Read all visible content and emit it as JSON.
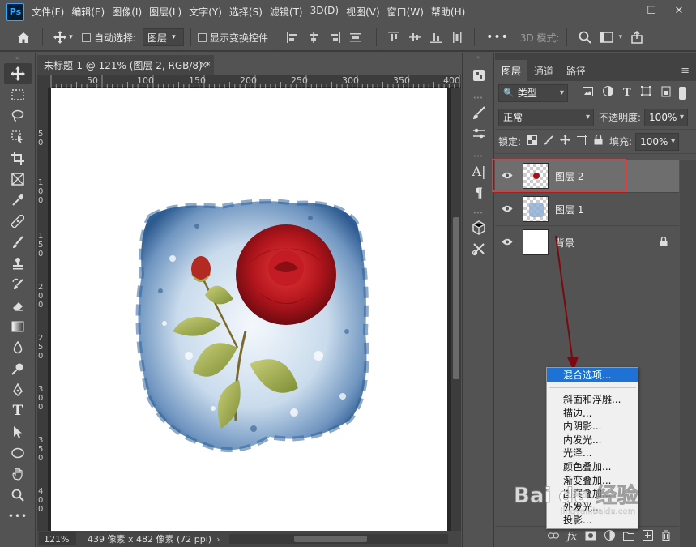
{
  "menubar": {
    "logo": "Ps",
    "items": [
      "文件(F)",
      "编辑(E)",
      "图像(I)",
      "图层(L)",
      "文字(Y)",
      "选择(S)",
      "滤镜(T)",
      "3D(D)",
      "视图(V)",
      "窗口(W)",
      "帮助(H)"
    ],
    "minimize_icon": "—",
    "maximize_icon": "☐",
    "close_icon": "✕"
  },
  "options": {
    "auto_select_label": "自动选择:",
    "auto_select_value": "图层",
    "show_transform_label": "显示变换控件",
    "mode_label": "3D 模式:",
    "more_icon": "•••"
  },
  "document": {
    "tab_title": "未标题-1 @ 121% (图层 2, RGB/8) *",
    "tab_close": "×",
    "ruler_h_ticks": [
      "50",
      "100",
      "150",
      "200",
      "250",
      "300",
      "350",
      "400"
    ],
    "ruler_v_ticks": [
      "50",
      "100",
      "150",
      "200",
      "250",
      "300",
      "350",
      "400",
      "450"
    ]
  },
  "status": {
    "zoom": "121%",
    "doc_info": "439 像素 x 482 像素 (72 ppi)",
    "arrow": "›"
  },
  "layers_panel": {
    "tabs": [
      "图层",
      "通道",
      "路径"
    ],
    "menu_icon": "≡",
    "filter_kind": "类型",
    "blend_mode": "正常",
    "opacity_label": "不透明度:",
    "opacity_value": "100%",
    "lock_label": "锁定:",
    "fill_label": "填充:",
    "fill_value": "100%",
    "layers": [
      {
        "name": "图层 2",
        "selected": true
      },
      {
        "name": "图层 1",
        "selected": false
      },
      {
        "name": "背景",
        "selected": false
      }
    ]
  },
  "context_menu": {
    "items": [
      "混合选项...",
      "斜面和浮雕...",
      "描边...",
      "内阴影...",
      "内发光...",
      "光泽...",
      "颜色叠加...",
      "渐变叠加...",
      "图案叠加...",
      "外发光...",
      "投影..."
    ]
  },
  "watermark": {
    "text": "Bai du 经验",
    "sub": "jingyan.baidu.com"
  },
  "colors": {
    "highlight_box": "#e33b3b",
    "menu_highlight": "#1e72d6",
    "ps_blue": "#31a8ff"
  }
}
